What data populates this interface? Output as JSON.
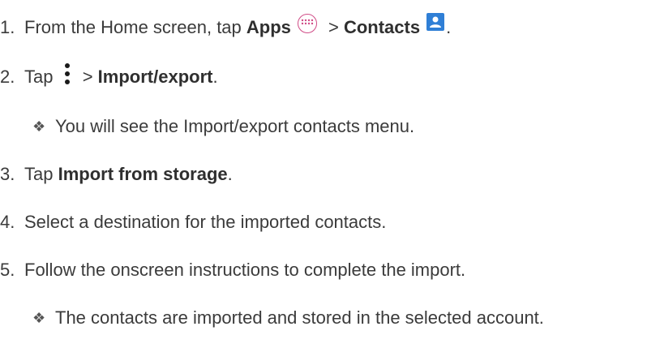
{
  "steps": [
    {
      "num": "1.",
      "pre": "From the Home screen, tap ",
      "bold1": "Apps",
      "sep": " > ",
      "bold2": "Contacts",
      "post": "."
    },
    {
      "num": "2.",
      "pre": "Tap ",
      "sep": " > ",
      "bold": "Import/export",
      "post": "."
    },
    {
      "num": "3.",
      "pre": "Tap ",
      "bold": "Import from storage",
      "post": "."
    },
    {
      "num": "4.",
      "text": "Select a destination for the imported contacts."
    },
    {
      "num": "5.",
      "text": "Follow the onscreen instructions to complete the import."
    }
  ],
  "notes": [
    {
      "symbol": "❖",
      "text": "You will see the Import/export contacts menu."
    },
    {
      "symbol": "❖",
      "text": "The contacts are imported and stored in the selected account."
    }
  ],
  "icons": {
    "apps": "apps-icon",
    "contacts": "contacts-icon",
    "menu": "more-options-icon",
    "apps_color": "#d04b86",
    "contacts_color": "#2f7fd6"
  }
}
